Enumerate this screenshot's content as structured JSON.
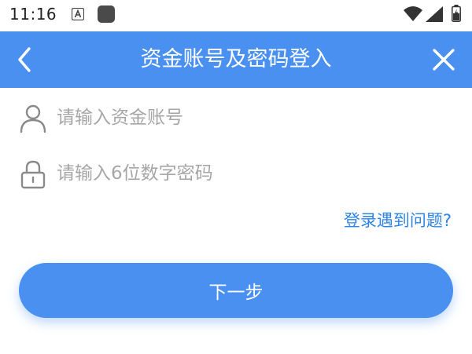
{
  "status_bar": {
    "time": "11:16",
    "icons": [
      "a-icon",
      "app-icon",
      "wifi-icon",
      "signal-icon",
      "battery-icon"
    ]
  },
  "header": {
    "title": "资金账号及密码登入",
    "back_icon": "chevron-left-icon",
    "close_icon": "close-icon"
  },
  "form": {
    "account": {
      "icon": "user-icon",
      "placeholder": "请输入资金账号",
      "value": ""
    },
    "password": {
      "icon": "lock-icon",
      "placeholder": "请输入6位数字密码",
      "value": ""
    }
  },
  "help_link": "登录遇到问题?",
  "next_button": "下一步",
  "colors": {
    "primary": "#4a90f0",
    "link": "#2f85e6",
    "placeholder": "#a6a6a6",
    "icon": "#8a8a8a"
  }
}
